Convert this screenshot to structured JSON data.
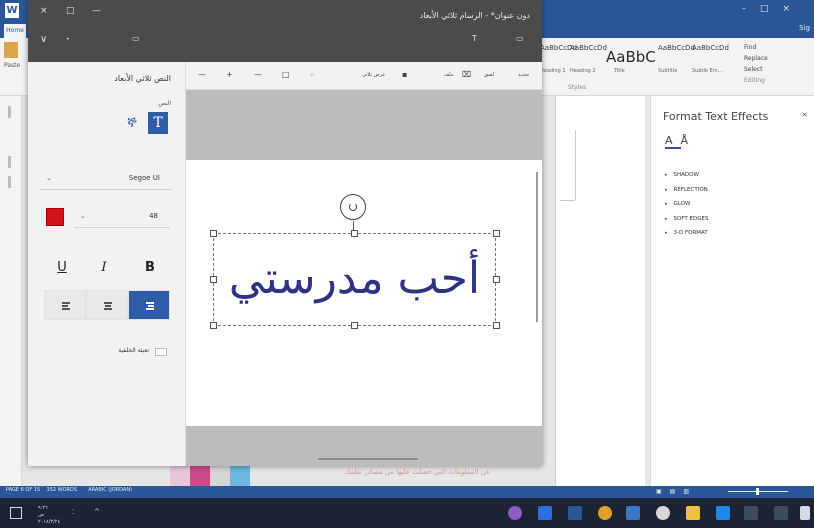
{
  "word": {
    "app_icon": "W",
    "home_tab": "Home",
    "help_text": "Sig",
    "styles": [
      {
        "sample": "AaBbCcDd",
        "name": "Heading 1"
      },
      {
        "sample": "AaBbCcDd",
        "name": "Heading 2"
      },
      {
        "sample": "AaBbC",
        "name": "Title"
      },
      {
        "sample": "AaBbCcDd",
        "name": "Subtitle"
      },
      {
        "sample": "AaBbCcDd",
        "name": "Subtle Em..."
      }
    ],
    "styles_group_label": "Styles",
    "editing": {
      "find": "Find",
      "replace": "Replace",
      "select": "Select",
      "group_label": "Editing"
    },
    "clipboard_label": "Paste"
  },
  "format_text_effects": {
    "title": "Format Text Effects",
    "close": "×",
    "items": [
      "SHADOW",
      "REFLECTION",
      "GLOW",
      "SOFT EDGES",
      "3-D FORMAT"
    ]
  },
  "status_bar": {
    "page": "PAGE 6 OF 15",
    "words": "352 WORDS",
    "language": "ARABIC (JORDAN)"
  },
  "taskbar": {
    "clock_line1": "٩:٢٦",
    "clock_line2": "ص",
    "clock_line3": "٢٠١٨/٣/٢٤"
  },
  "paint3d": {
    "title": "دون عنوان* - الرسام ثلاثي الأبعاد",
    "window_controls": [
      "×",
      "□",
      "—"
    ],
    "menu_left": "∨",
    "menu_right": "T",
    "panel": {
      "title": "النص ثلاثي الأبعاد",
      "type_label": "النص",
      "font": "Segoe UI",
      "size": "48",
      "underline": "U",
      "italic": "I",
      "bold": "B",
      "background_fill": "تعبئة الخلفية"
    },
    "toolbar": {
      "zoom_out": "—",
      "zoom_plus": "+",
      "minus": "—",
      "frame": "□",
      "clip": "قطع",
      "paste": "لصق",
      "canvas": "ملف",
      "new": "تحديد",
      "three_d_view": "عرض ثلاثي"
    },
    "canvas_text": "أحب مدرستي"
  },
  "colors": {
    "word_blue": "#2b579a",
    "paint_title": "#4b4b4b",
    "accent": "#2e5ca8",
    "text_color": "#d1141b",
    "canvas_text": "#2f3386"
  }
}
